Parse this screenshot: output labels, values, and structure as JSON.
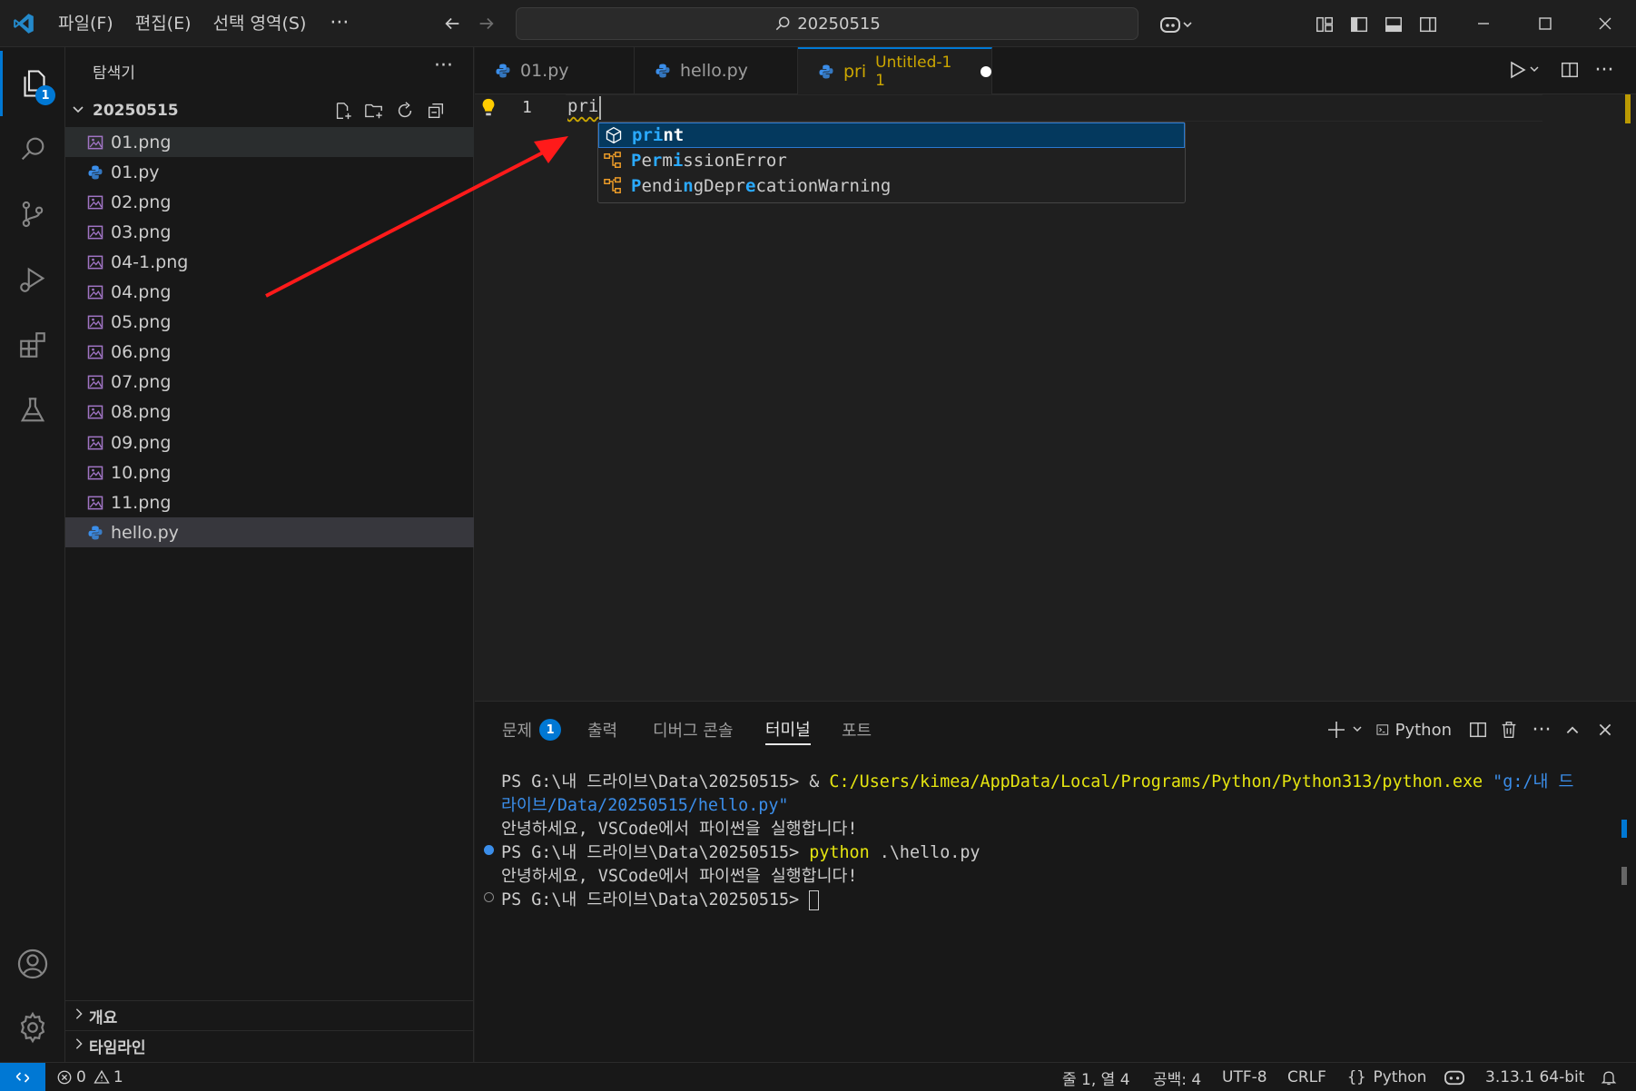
{
  "menu": [
    "파일(F)",
    "편집(E)",
    "선택 영역(S)",
    "···"
  ],
  "search": {
    "text": "20250515"
  },
  "activity": {
    "explorer_badge": "1"
  },
  "sidebar": {
    "title": "탐색기",
    "more": "···",
    "folder": "20250515",
    "files": [
      {
        "name": "01.png",
        "type": "image"
      },
      {
        "name": "01.py",
        "type": "python"
      },
      {
        "name": "02.png",
        "type": "image"
      },
      {
        "name": "03.png",
        "type": "image"
      },
      {
        "name": "04-1.png",
        "type": "image"
      },
      {
        "name": "04.png",
        "type": "image"
      },
      {
        "name": "05.png",
        "type": "image"
      },
      {
        "name": "06.png",
        "type": "image"
      },
      {
        "name": "07.png",
        "type": "image"
      },
      {
        "name": "08.png",
        "type": "image"
      },
      {
        "name": "09.png",
        "type": "image"
      },
      {
        "name": "10.png",
        "type": "image"
      },
      {
        "name": "11.png",
        "type": "image"
      },
      {
        "name": "hello.py",
        "type": "python"
      }
    ],
    "outline": "개요",
    "timeline": "타임라인"
  },
  "tabs": [
    {
      "label": "01.py"
    },
    {
      "label": "hello.py"
    },
    {
      "label": "pri",
      "detail": "Untitled-1 1"
    }
  ],
  "editor": {
    "line_number": "1",
    "code": "pri"
  },
  "suggestions": [
    {
      "label": "print",
      "match": "pri",
      "rest": "nt",
      "kind": "function"
    },
    {
      "label": "PermissionError",
      "kind": "class"
    },
    {
      "label": "PendingDeprecationWarning",
      "kind": "class"
    }
  ],
  "panel": {
    "tabs": {
      "problems": "문제",
      "problems_badge": "1",
      "output": "출력",
      "debug_console": "디버그 콘솔",
      "terminal": "터미널",
      "ports": "포트"
    },
    "terminal_name": "Python",
    "terminal": {
      "line1_prompt": "PS G:\\내 드라이브\\Data\\20250515> ",
      "line1_amp": "& ",
      "line1_exe": "C:/Users/kimea/AppData/Local/Programs/Python/Python313/python.exe",
      "line1_arg_a": " \"g:/내 드",
      "line2_arg_b": "라이브/Data/20250515/hello.py\"",
      "line3_output": "안녕하세요, VSCode에서 파이썬을 실행합니다!",
      "line4_prompt": "PS G:\\내 드라이브\\Data\\20250515> ",
      "line4_cmd": "python",
      "line4_arg": " .\\hello.py",
      "line5_output": "안녕하세요, VSCode에서 파이썬을 실행합니다!",
      "line6_prompt": "PS G:\\내 드라이브\\Data\\20250515> "
    }
  },
  "status": {
    "errors": "0",
    "warnings": "1",
    "position": "줄 1, 열 4",
    "spaces": "공백: 4",
    "encoding": "UTF-8",
    "eol": "CRLF",
    "language": "Python",
    "interpreter": "3.13.1 64-bit"
  },
  "colors": {
    "accent": "#0078d4",
    "annotation_arrow": "#ff0000",
    "warning": "#cca700"
  }
}
